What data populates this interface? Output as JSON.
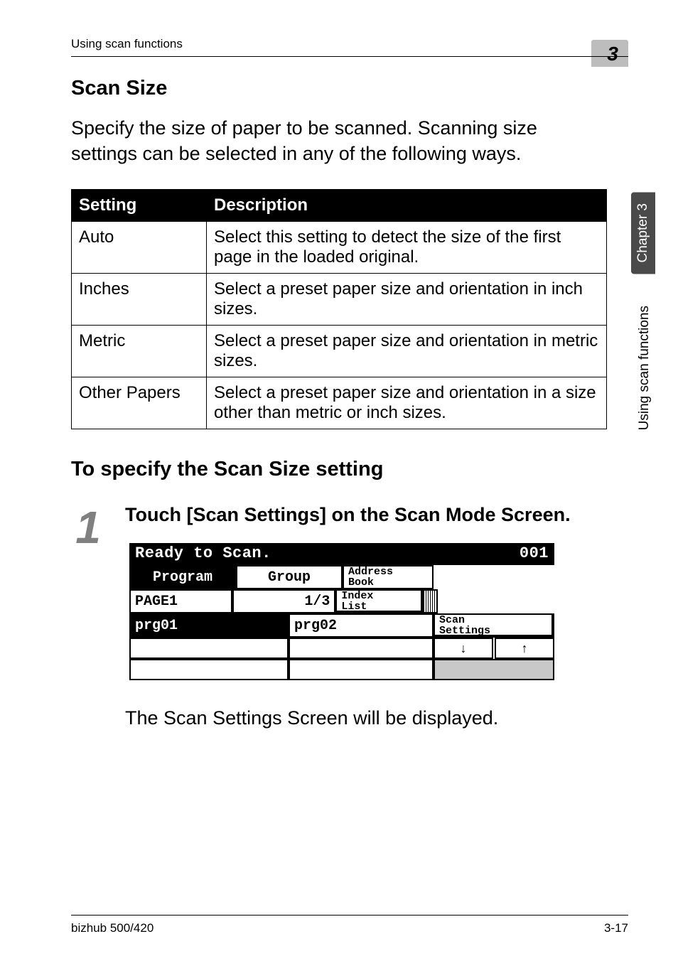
{
  "header": {
    "left": "Using scan functions",
    "chapterNum": "3"
  },
  "side": {
    "chapter": "Chapter 3",
    "using": "Using scan functions"
  },
  "section_title": "Scan Size",
  "lead": "Specify the size of paper to be scanned. Scanning size settings can be selected in any of the following ways.",
  "table": {
    "headers": [
      "Setting",
      "Description"
    ],
    "rows": [
      {
        "setting": "Auto",
        "desc": "Select this setting to detect the size of the first page in the loaded original."
      },
      {
        "setting": "Inches",
        "desc": "Select a preset paper size and orientation in inch sizes."
      },
      {
        "setting": "Metric",
        "desc": "Select a preset paper size and orientation in metric sizes."
      },
      {
        "setting": "Other Papers",
        "desc": "Select a preset paper size and orientation in a size other than metric or inch sizes."
      }
    ]
  },
  "subsection_title": "To specify the Scan Size setting",
  "step": {
    "num": "1",
    "title": "Touch [Scan Settings] on the Scan Mode Screen."
  },
  "lcd": {
    "status": "Ready to Scan.",
    "jobnum": "001",
    "tabs": {
      "program": "Program",
      "group": "Group",
      "address1": "Address",
      "address2": "Book"
    },
    "page": "PAGE1",
    "count": "1/3",
    "index1": "Index",
    "index2": "List",
    "prg1": "prg01",
    "prg2": "prg02",
    "scan1": "Scan",
    "scan2": "Settings",
    "arrow_down": "↓",
    "arrow_up": "↑"
  },
  "after_lcd": "The Scan Settings Screen will be displayed.",
  "footer": {
    "left": "bizhub 500/420",
    "right": "3-17"
  }
}
